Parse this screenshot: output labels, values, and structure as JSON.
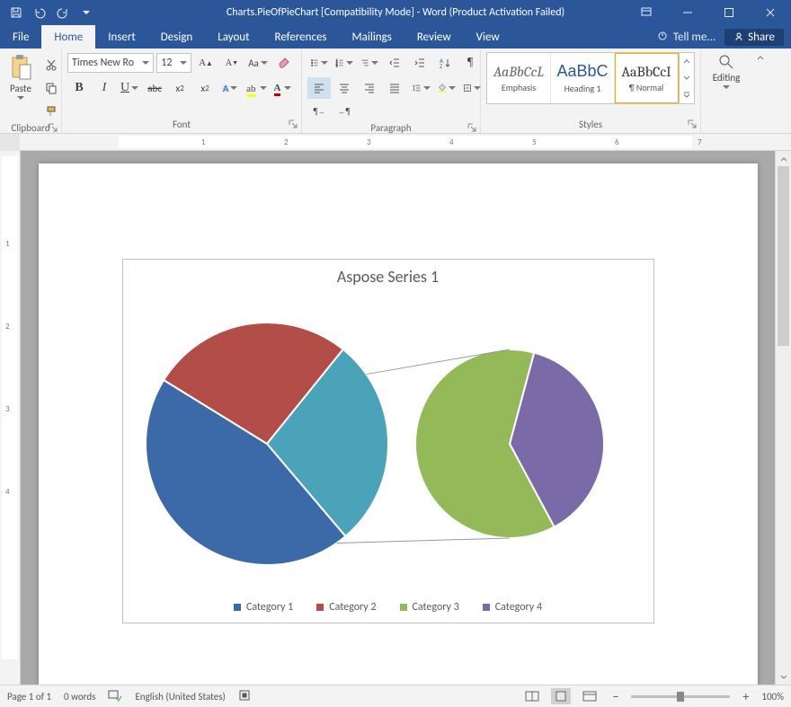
{
  "titlebar": {
    "title": "Charts.PieOfPieChart [Compatibility Mode] - Word (Product Activation Failed)"
  },
  "tabs": {
    "file": "File",
    "home": "Home",
    "insert": "Insert",
    "design": "Design",
    "layout": "Layout",
    "references": "References",
    "mailings": "Mailings",
    "review": "Review",
    "view": "View",
    "tell_me": "Tell me...",
    "share": "Share"
  },
  "ribbon": {
    "clipboard": {
      "label": "Clipboard",
      "paste": "Paste"
    },
    "font": {
      "label": "Font",
      "name": "Times New Ro",
      "size": "12"
    },
    "paragraph": {
      "label": "Paragraph"
    },
    "styles": {
      "label": "Styles",
      "items": [
        {
          "preview": "AaBbCcL",
          "name": "Emphasis",
          "cls": "em"
        },
        {
          "preview": "AaBbC",
          "name": "Heading 1",
          "cls": "blue"
        },
        {
          "preview": "AaBbCcI",
          "name": "¶ Normal",
          "cls": ""
        }
      ]
    },
    "editing": {
      "label": "Editing"
    }
  },
  "ruler_h": [
    "1",
    "2",
    "3",
    "4",
    "5",
    "6",
    "7"
  ],
  "ruler_v": [
    "1",
    "2",
    "3",
    "4"
  ],
  "chart_data": {
    "type": "pie-of-pie",
    "title": "Aspose Series 1",
    "categories": [
      "Category 1",
      "Category 2",
      "Category 3",
      "Category 4"
    ],
    "colors": [
      "#3c6aa8",
      "#b24d48",
      "#94b958",
      "#7b6aa8"
    ],
    "primary_pie": {
      "slices": [
        {
          "category": "Category 1",
          "value_pct": 45
        },
        {
          "category": "Category 2",
          "value_pct": 27
        },
        {
          "category": "Other (secondary)",
          "value_pct": 28
        }
      ]
    },
    "secondary_pie": {
      "slices": [
        {
          "category": "Category 3",
          "value_pct": 62
        },
        {
          "category": "Category 4",
          "value_pct": 38
        }
      ]
    },
    "legend": [
      "Category 1",
      "Category 2",
      "Category 3",
      "Category 4"
    ]
  },
  "statusbar": {
    "page": "Page 1 of 1",
    "words": "0 words",
    "language": "English (United States)",
    "zoom": "100%"
  }
}
